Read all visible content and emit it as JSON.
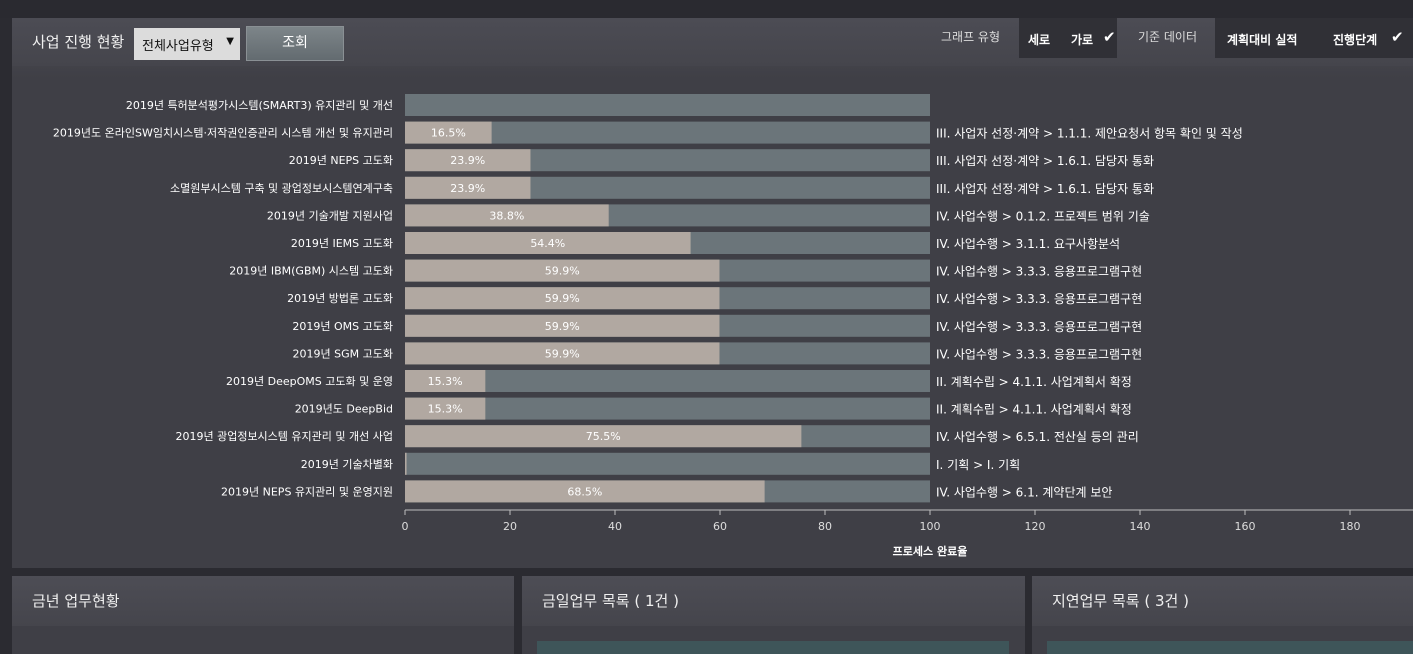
{
  "header": {
    "title": "사업 진행 현황",
    "select_value": "전체사업유형",
    "search_button": "조회",
    "graph_type_label": "그래프 유형",
    "graph_type_options": [
      "세로",
      "가로"
    ],
    "base_data_label": "기준 데이터",
    "base_data_options": [
      "계획대비 실적",
      "진행단계"
    ]
  },
  "colors": {
    "bar_fill": "#b1a8a1",
    "bar_track": "#6b757a",
    "check": "#ffffff"
  },
  "chart_data": {
    "type": "bar",
    "orientation": "horizontal",
    "xlabel": "프로세스 완료율",
    "xlim": [
      0,
      180
    ],
    "xticks": [
      0,
      20,
      40,
      60,
      80,
      100,
      120,
      140,
      160,
      180
    ],
    "track_max": 100,
    "categories": [
      "2019년 특허분석평가시스템(SMART3) 유지관리 및 개선",
      "2019년도 온라인SW임치시스템·저작권인증관리 시스템 개선 및 유지관리",
      "2019년 NEPS 고도화",
      "소멸원부시스템 구축 및 광업정보시스템연계구축",
      "2019년 기술개발 지원사업",
      "2019년 IEMS 고도화",
      "2019년 IBM(GBM) 시스템 고도화",
      "2019년 방법론 고도화",
      "2019년 OMS 고도화",
      "2019년 SGM 고도화",
      "2019년 DeepOMS 고도화 및 운영",
      "2019년도 DeepBid",
      "2019년 광업정보시스템 유지관리 및 개선 사업",
      "2019년 기술차별화",
      "2019년 NEPS 유지관리 및 운영지원"
    ],
    "values": [
      0,
      16.5,
      23.9,
      23.9,
      38.8,
      54.4,
      59.9,
      59.9,
      59.9,
      59.9,
      15.3,
      15.3,
      75.5,
      0.3,
      68.5
    ],
    "value_labels": [
      "",
      "16.5%",
      "23.9%",
      "23.9%",
      "38.8%",
      "54.4%",
      "59.9%",
      "59.9%",
      "59.9%",
      "59.9%",
      "15.3%",
      "15.3%",
      "75.5%",
      "",
      "68.5%"
    ],
    "stage_labels": [
      "",
      "III. 사업자 선정·계약 > 1.1.1. 제안요청서 항목 확인 및 작성",
      "III. 사업자 선정·계약 > 1.6.1. 담당자 통화",
      "III. 사업자 선정·계약 > 1.6.1. 담당자 통화",
      "IV. 사업수행 > 0.1.2. 프로젝트 범위 기술",
      "IV. 사업수행 > 3.1.1. 요구사항분석",
      "IV. 사업수행 > 3.3.3. 응용프로그램구현",
      "IV. 사업수행 > 3.3.3. 응용프로그램구현",
      "IV. 사업수행 > 3.3.3. 응용프로그램구현",
      "IV. 사업수행 > 3.3.3. 응용프로그램구현",
      "II. 계획수립 > 4.1.1. 사업계획서 확정",
      "II. 계획수립 > 4.1.1. 사업계획서 확정",
      "IV. 사업수행 > 6.5.1. 전산실 등의 관리",
      "I. 기획 > I. 기획",
      "IV. 사업수행 > 6.1. 계약단계 보안"
    ],
    "grid": false,
    "legend": "none"
  },
  "panels": {
    "yearly": {
      "title": "금년 업무현황"
    },
    "today": {
      "title": "금일업무 목록 ( 1건 )"
    },
    "delayed": {
      "title": "지연업무 목록 ( 3건 )"
    }
  }
}
